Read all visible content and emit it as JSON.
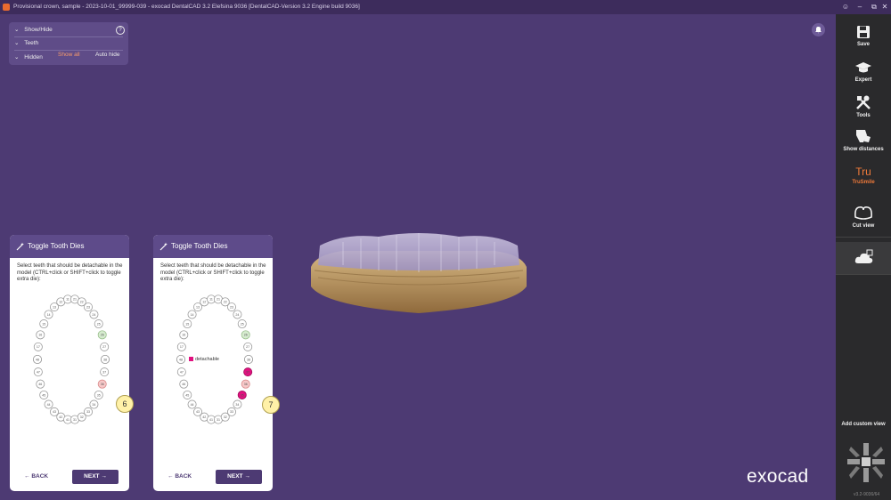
{
  "window": {
    "title": "Provisional crown, sample - 2023-10-01_99999-039 - exocad DentalCAD 3.2 Elefsina 9036 [DentalCAD-Version 3.2 Engine build 9036]",
    "controls": {
      "user": "☺",
      "minimize": "–",
      "maximize": "⧉",
      "close": "✕"
    }
  },
  "showhide_panel": {
    "show_hide_label": "Show/Hide",
    "teeth_label": "Teeth",
    "hidden_label": "Hidden",
    "show_all_label": "Show all",
    "auto_hide_label": "Auto hide",
    "help": "?"
  },
  "sidebar": {
    "items": [
      {
        "label": "Save",
        "icon": "save-icon"
      },
      {
        "label": "Expert",
        "icon": "graduation-cap-icon"
      },
      {
        "label": "Tools",
        "icon": "tools-icon"
      },
      {
        "label": "Show distances",
        "icon": "show-distances-icon"
      },
      {
        "label": "TruSmile",
        "icon": "trusmile-icon",
        "glyph": "Tru"
      },
      {
        "label": "Cut view",
        "icon": "cut-view-icon"
      }
    ],
    "add_custom_view_label": "Add custom view",
    "version": "v3.2-9036/64"
  },
  "dialogs": [
    {
      "title": "Toggle Tooth Dies",
      "instructions": "Select teeth that should be detachable in the model (CTRL+click or SHIFT+click to toggle extra die):",
      "back_label": "BACK",
      "next_label": "NEXT",
      "step": "6",
      "legend_label": ""
    },
    {
      "title": "Toggle Tooth Dies",
      "instructions": "Select teeth that should be detachable in the model (CTRL+click or SHIFT+click to toggle extra die):",
      "back_label": "BACK",
      "next_label": "NEXT",
      "step": "7",
      "legend_label": "detachable"
    }
  ],
  "brand": "exocad",
  "colors": {
    "viewport": "#4d3a73",
    "accent_orange": "#f07a3a",
    "detachable": "#e0117f",
    "highlight_pink": "#f7c9c9",
    "highlight_green": "#cfe8c4"
  }
}
